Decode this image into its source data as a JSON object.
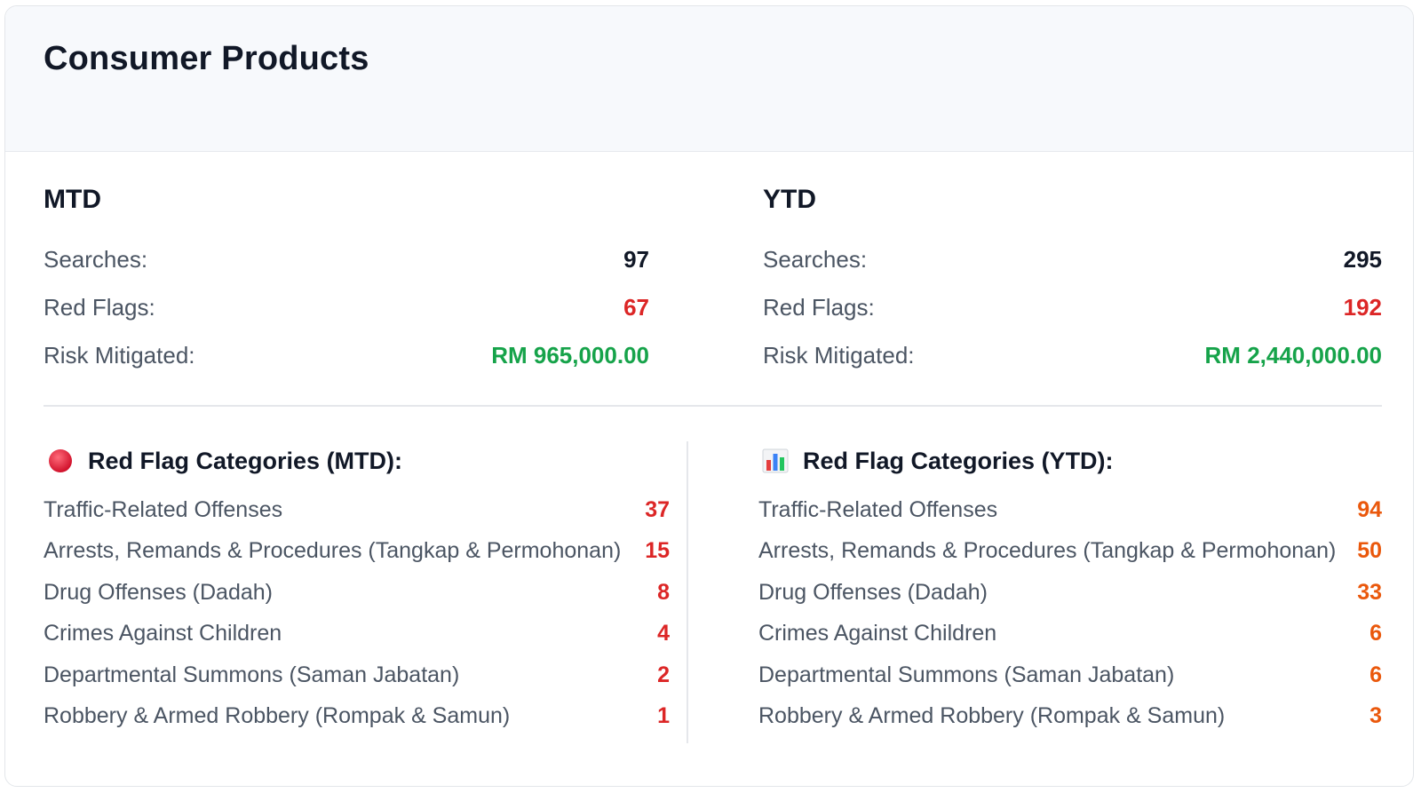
{
  "header": {
    "title": "Consumer Products"
  },
  "summary": {
    "mtd": {
      "title": "MTD",
      "searches_label": "Searches:",
      "searches": "97",
      "red_flags_label": "Red Flags:",
      "red_flags": "67",
      "risk_label": "Risk Mitigated:",
      "risk": "RM 965,000.00"
    },
    "ytd": {
      "title": "YTD",
      "searches_label": "Searches:",
      "searches": "295",
      "red_flags_label": "Red Flags:",
      "red_flags": "192",
      "risk_label": "Risk Mitigated:",
      "risk": "RM 2,440,000.00"
    }
  },
  "categories": {
    "mtd": {
      "title": "Red Flag Categories (MTD):",
      "icon": "red-circle-icon",
      "items": [
        {
          "label": "Traffic-Related Offenses",
          "count": "37"
        },
        {
          "label": "Arrests, Remands & Procedures (Tangkap & Permohonan)",
          "count": "15"
        },
        {
          "label": "Drug Offenses (Dadah)",
          "count": "8"
        },
        {
          "label": "Crimes Against Children",
          "count": "4"
        },
        {
          "label": "Departmental Summons (Saman Jabatan)",
          "count": "2"
        },
        {
          "label": "Robbery & Armed Robbery (Rompak & Samun)",
          "count": "1"
        }
      ]
    },
    "ytd": {
      "title": "Red Flag Categories (YTD):",
      "icon": "bar-chart-icon",
      "items": [
        {
          "label": "Traffic-Related Offenses",
          "count": "94"
        },
        {
          "label": "Arrests, Remands & Procedures (Tangkap & Permohonan)",
          "count": "50"
        },
        {
          "label": "Drug Offenses (Dadah)",
          "count": "33"
        },
        {
          "label": "Crimes Against Children",
          "count": "6"
        },
        {
          "label": "Departmental Summons (Saman Jabatan)",
          "count": "6"
        },
        {
          "label": "Robbery & Armed Robbery (Rompak & Samun)",
          "count": "3"
        }
      ]
    }
  },
  "colors": {
    "red": "#dc2626",
    "green": "#16a34a",
    "orange": "#ea580c"
  }
}
